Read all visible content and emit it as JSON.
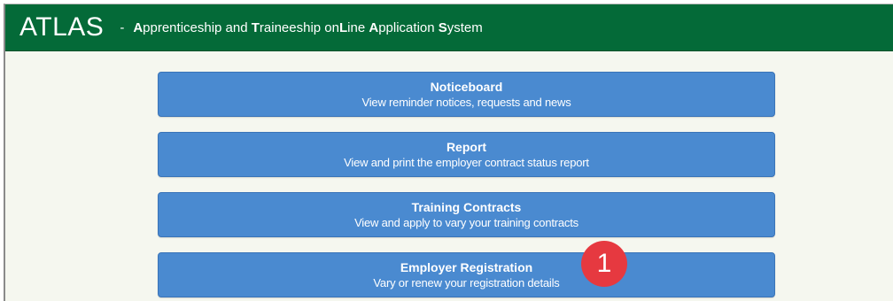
{
  "header": {
    "logo": "ATLAS",
    "dash": "-",
    "tagline_parts": [
      {
        "b": "A",
        "t": "pprenticeship and "
      },
      {
        "b": "T",
        "t": "raineeship on"
      },
      {
        "b": "L",
        "t": "ine "
      },
      {
        "b": "A",
        "t": "pplication "
      },
      {
        "b": "S",
        "t": "ystem"
      }
    ]
  },
  "menu": {
    "items": [
      {
        "title": "Noticeboard",
        "subtitle": "View reminder notices, requests and news"
      },
      {
        "title": "Report",
        "subtitle": "View and print the employer contract status report"
      },
      {
        "title": "Training Contracts",
        "subtitle": "View  and apply to vary your training contracts"
      },
      {
        "title": "Employer Registration",
        "subtitle": "Vary or renew your registration details"
      }
    ]
  },
  "annotation": {
    "badge_label": "1",
    "badge_color": "#e63940"
  },
  "colors": {
    "header_bg": "#046a38",
    "button_bg": "#4a8ad0",
    "page_bg": "#f5f7ef"
  }
}
